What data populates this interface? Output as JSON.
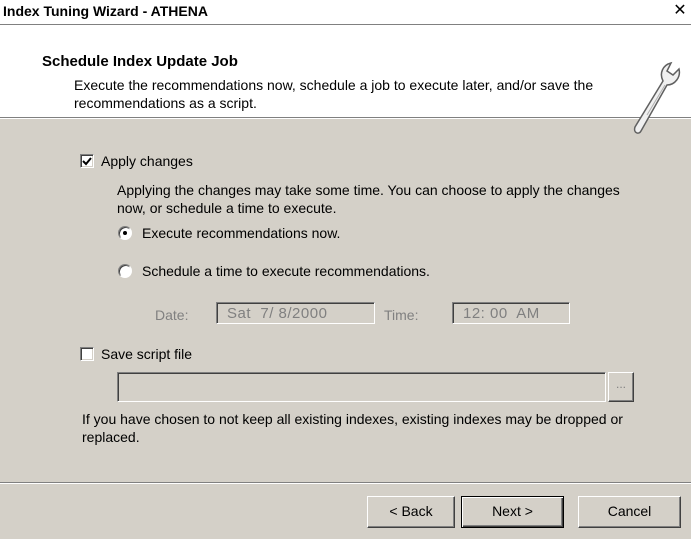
{
  "window": {
    "title": "Index Tuning Wizard - ATHENA",
    "close_glyph": "✕"
  },
  "header": {
    "title": "Schedule Index Update Job",
    "description": "Execute the recommendations now, schedule a job to execute later, and/or save the recommendations as a script.",
    "icon": "wrench-icon"
  },
  "apply_changes": {
    "label": "Apply changes",
    "checked": true,
    "description": "Applying the changes may take some time. You can choose to apply the changes now, or schedule a time to execute.",
    "options": [
      {
        "label": "Execute recommendations now.",
        "selected": true
      },
      {
        "label": "Schedule a time to execute recommendations.",
        "selected": false
      }
    ],
    "date_label": "Date:",
    "date_value": "Sat  7/ 8/2000",
    "time_label": "Time:",
    "time_value": "12: 00  AM"
  },
  "save_script": {
    "label": "Save script file",
    "checked": false,
    "path": "",
    "browse_label": "..."
  },
  "note": "If you have chosen to not keep all existing indexes, existing indexes may be dropped or replaced.",
  "buttons": {
    "back": "< Back",
    "next": "Next >",
    "cancel": "Cancel"
  },
  "colors": {
    "face": "#d4d0c8",
    "header_bg": "#ffffff",
    "disabled_text": "#808080"
  }
}
